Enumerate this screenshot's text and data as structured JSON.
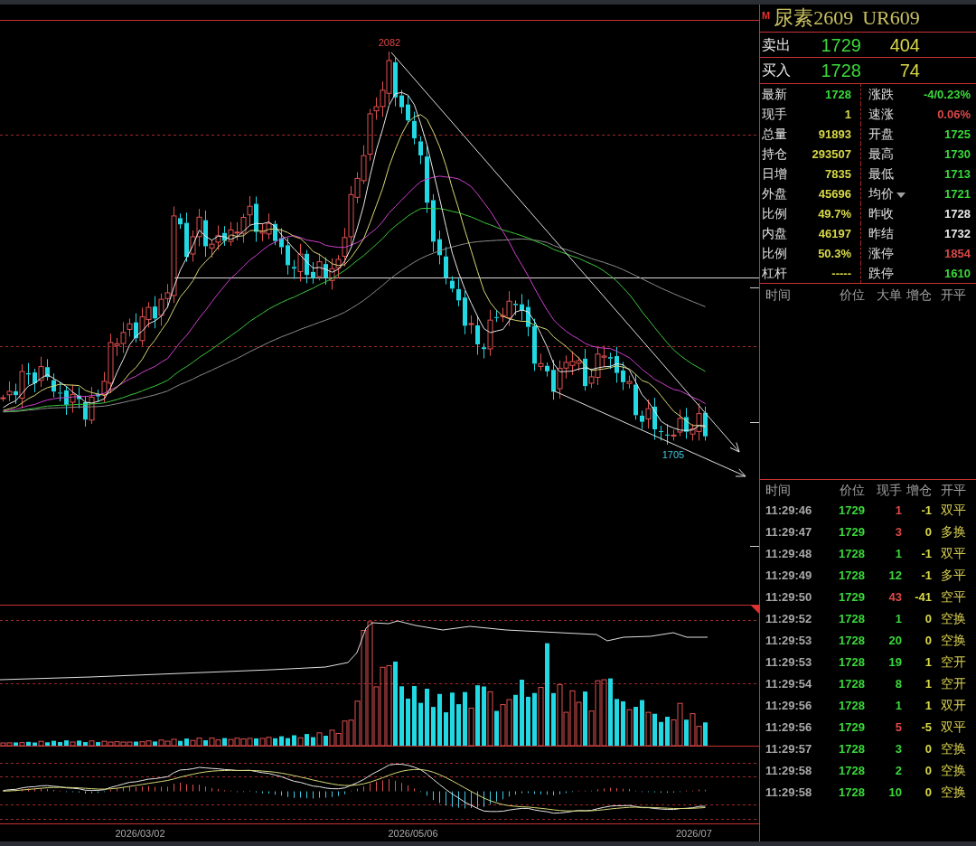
{
  "chart": {
    "high_label": "2082",
    "low_label": "1705",
    "date_labels": [
      "2026/03/02",
      "2026/05/06",
      "2026/07"
    ]
  },
  "quote": {
    "badge": "M",
    "title": "尿素2609",
    "code": "UR609",
    "ask": {
      "label": "卖出",
      "price": "1729",
      "volume": "404"
    },
    "bid": {
      "label": "买入",
      "price": "1728",
      "volume": "74"
    },
    "stats": [
      {
        "label": "最新",
        "value": "1728",
        "color": "#3ad83a",
        "dropdown": false
      },
      {
        "label": "涨跌",
        "value": "-4/0.23%",
        "color": "#3ad83a",
        "dropdown": false
      },
      {
        "label": "现手",
        "value": "1",
        "color": "#d8d848",
        "dropdown": false
      },
      {
        "label": "速涨",
        "value": "0.06%",
        "color": "#d84848",
        "dropdown": false
      },
      {
        "label": "总量",
        "value": "91893",
        "color": "#d8d848",
        "dropdown": false
      },
      {
        "label": "开盘",
        "value": "1725",
        "color": "#3ad83a",
        "dropdown": false
      },
      {
        "label": "持仓",
        "value": "293507",
        "color": "#d8d848",
        "dropdown": false
      },
      {
        "label": "最高",
        "value": "1730",
        "color": "#3ad83a",
        "dropdown": false
      },
      {
        "label": "日增",
        "value": "7835",
        "color": "#d8d848",
        "dropdown": false
      },
      {
        "label": "最低",
        "value": "1713",
        "color": "#3ad83a",
        "dropdown": false
      },
      {
        "label": "外盘",
        "value": "45696",
        "color": "#d8d848",
        "dropdown": false
      },
      {
        "label": "均价",
        "value": "1721",
        "color": "#3ad83a",
        "dropdown": true
      },
      {
        "label": "比例",
        "value": "49.7%",
        "color": "#d8d848",
        "dropdown": false
      },
      {
        "label": "昨收",
        "value": "1728",
        "color": "#e8e8e8",
        "dropdown": false
      },
      {
        "label": "内盘",
        "value": "46197",
        "color": "#d8d848",
        "dropdown": false
      },
      {
        "label": "昨结",
        "value": "1732",
        "color": "#e8e8e8",
        "dropdown": false
      },
      {
        "label": "比例",
        "value": "50.3%",
        "color": "#d8d848",
        "dropdown": false
      },
      {
        "label": "涨停",
        "value": "1854",
        "color": "#d84848",
        "dropdown": false
      },
      {
        "label": "杠杆",
        "value": "-----",
        "color": "#d8d848",
        "dropdown": false
      },
      {
        "label": "跌停",
        "value": "1610",
        "color": "#3ad83a",
        "dropdown": false
      }
    ]
  },
  "big_orders": {
    "columns": [
      "时间",
      "价位",
      "大单",
      "增仓",
      "开平"
    ]
  },
  "ticks": {
    "columns": [
      "时间",
      "价位",
      "现手",
      "增仓",
      "开平"
    ],
    "rows": [
      {
        "time": "11:29:46",
        "price": "1729",
        "volume": "1",
        "color": "#e04848",
        "oi_change": "-1",
        "open_close": "双平"
      },
      {
        "time": "11:29:47",
        "price": "1729",
        "volume": "3",
        "color": "#e04848",
        "oi_change": "0",
        "open_close": "多换"
      },
      {
        "time": "11:29:48",
        "price": "1728",
        "volume": "1",
        "color": "#3ad83a",
        "oi_change": "-1",
        "open_close": "双平"
      },
      {
        "time": "11:29:49",
        "price": "1728",
        "volume": "12",
        "color": "#3ad83a",
        "oi_change": "-1",
        "open_close": "多平"
      },
      {
        "time": "11:29:50",
        "price": "1729",
        "volume": "43",
        "color": "#e04848",
        "oi_change": "-41",
        "open_close": "空平"
      },
      {
        "time": "11:29:52",
        "price": "1728",
        "volume": "1",
        "color": "#3ad83a",
        "oi_change": "0",
        "open_close": "空换"
      },
      {
        "time": "11:29:53",
        "price": "1728",
        "volume": "20",
        "color": "#3ad83a",
        "oi_change": "0",
        "open_close": "空换"
      },
      {
        "time": "11:29:53",
        "price": "1728",
        "volume": "19",
        "color": "#3ad83a",
        "oi_change": "1",
        "open_close": "空开"
      },
      {
        "time": "11:29:54",
        "price": "1728",
        "volume": "8",
        "color": "#3ad83a",
        "oi_change": "1",
        "open_close": "空开"
      },
      {
        "time": "11:29:56",
        "price": "1728",
        "volume": "1",
        "color": "#3ad83a",
        "oi_change": "1",
        "open_close": "双开"
      },
      {
        "time": "11:29:56",
        "price": "1729",
        "volume": "5",
        "color": "#e04848",
        "oi_change": "-5",
        "open_close": "双平"
      },
      {
        "time": "11:29:57",
        "price": "1728",
        "volume": "3",
        "color": "#3ad83a",
        "oi_change": "0",
        "open_close": "空换"
      },
      {
        "time": "11:29:58",
        "price": "1728",
        "volume": "2",
        "color": "#3ad83a",
        "oi_change": "0",
        "open_close": "空换"
      },
      {
        "time": "11:29:58",
        "price": "1728",
        "volume": "10",
        "color": "#3ad83a",
        "oi_change": "0",
        "open_close": "空换"
      }
    ]
  }
}
